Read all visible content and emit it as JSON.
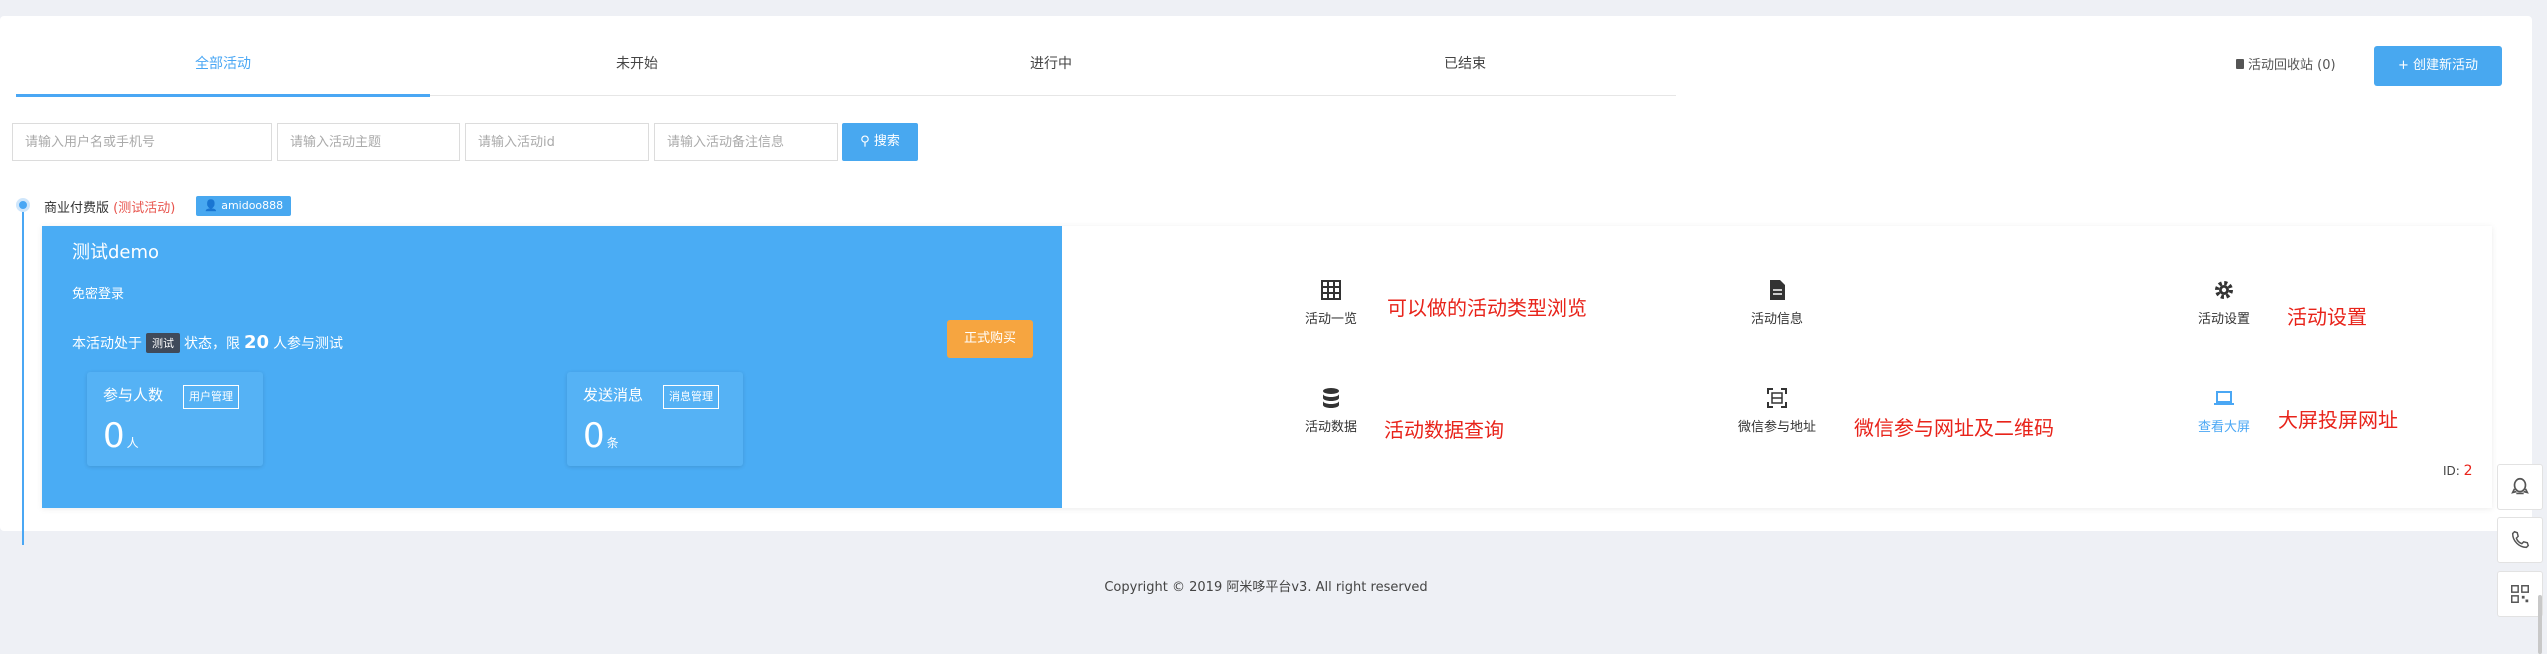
{
  "tabs": [
    {
      "label": "全部活动",
      "active": true
    },
    {
      "label": "未开始",
      "active": false
    },
    {
      "label": "进行中",
      "active": false
    },
    {
      "label": "已结束",
      "active": false
    }
  ],
  "recycle_bin": "活动回收站 (0)",
  "create_button": "+ 创建新活动",
  "search": {
    "user_placeholder": "请输入用户名或手机号",
    "theme_placeholder": "请输入活动主题",
    "id_placeholder": "请输入活动id",
    "note_placeholder": "请输入活动备注信息",
    "button": "搜索"
  },
  "activity": {
    "edition": "商业付费版",
    "edition_tag": "(测试活动)",
    "user": "amidoo888",
    "title": "测试demo",
    "login_mode": "免密登录",
    "status_prefix": "本活动处于",
    "status_badge": "测试",
    "status_mid": "状态，限",
    "limit": "20",
    "status_suffix": "人参与测试",
    "buy_button": "正式购买",
    "participants": {
      "label": "参与人数",
      "button": "用户管理",
      "value": "0",
      "unit": "人"
    },
    "messages": {
      "label": "发送消息",
      "button": "消息管理",
      "value": "0",
      "unit": "条"
    },
    "id_label": "ID:",
    "id_value": "2"
  },
  "actions": {
    "overview": "活动一览",
    "info": "活动信息",
    "settings": "活动设置",
    "data": "活动数据",
    "wechat_url": "微信参与地址",
    "big_screen": "查看大屏"
  },
  "annotations": {
    "overview": "可以做的活动类型浏览",
    "settings": "活动设置",
    "data": "活动数据查询",
    "wechat": "微信参与网址及二维码",
    "screen": "大屏投屏网址"
  },
  "footer": "Copyright © 2019 阿米哆平台v3. All right reserved",
  "colors": {
    "primary": "#4aacf4",
    "orange": "#f6a540",
    "annotation": "#e8231a"
  }
}
